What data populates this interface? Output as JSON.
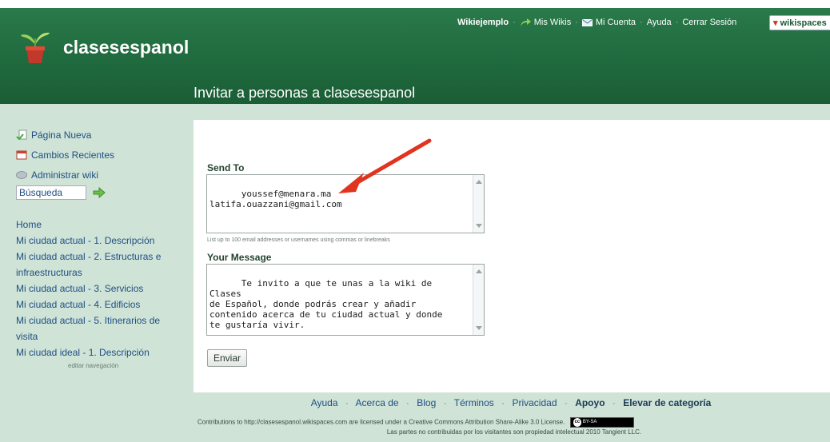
{
  "header": {
    "site_name": "clasesespanol",
    "page_title": "Invitar a personas a clasesespanol",
    "topnav": {
      "wikiejemplo": "Wikiejemplo",
      "mis_wikis": "Mis Wikis",
      "mi_cuenta": "Mi Cuenta",
      "ayuda": "Ayuda",
      "cerrar_sesion": "Cerrar Sesión",
      "brand_badge": "wikispaces"
    }
  },
  "sidebar": {
    "tools": [
      {
        "label": "Página Nueva",
        "icon": "new-page-icon"
      },
      {
        "label": "Cambios Recientes",
        "icon": "calendar-icon"
      },
      {
        "label": "Administrar wiki",
        "icon": "manage-wiki-icon"
      }
    ],
    "search_value": "Búsqueda",
    "nav": [
      "Home",
      "Mi ciudad actual - 1. Descripción",
      "Mi ciudad actual - 2. Estructuras e",
      "infraestructuras",
      "Mi ciudad actual - 3. Servicios",
      "Mi ciudad actual - 4. Edificios",
      "Mi ciudad actual - 5. Itinerarios de",
      "visita",
      "Mi ciudad ideal - 1. Descripción"
    ],
    "edit_nav": "editar navegación"
  },
  "form": {
    "send_to_label": "Send To",
    "send_to_value": "youssef@menara.ma\nlatifa.ouazzani@gmail.com",
    "hint": "List up to 100 email addresses or usernames using commas or linebreaks",
    "message_label": "Your Message",
    "message_value": "Te invito a que te unas a la wiki de Clases\nde Español, donde podrás crear y añadir\ncontenido acerca de tu ciudad actual y donde\nte gustaría vivir.",
    "send_button": "Enviar"
  },
  "footer": {
    "links": [
      "Ayuda",
      "Acerca de",
      "Blog",
      "Términos",
      "Privacidad"
    ],
    "strong_links": [
      "Apoyo",
      "Elevar de categoría"
    ],
    "license": "Contributions to http://clasesespanol.wikispaces.com are licensed under a Creative Commons Attribution Share-Alike 3.0 License.",
    "rights": "Las partes no contribuidas por los visitantes son propiedad intelectual 2010 Tangient LLC."
  },
  "colors": {
    "header_green": "#1f6a3e",
    "page_bg": "#cfe3d7",
    "link_blue": "#1f4f82",
    "arrow_red": "#e0341f"
  }
}
